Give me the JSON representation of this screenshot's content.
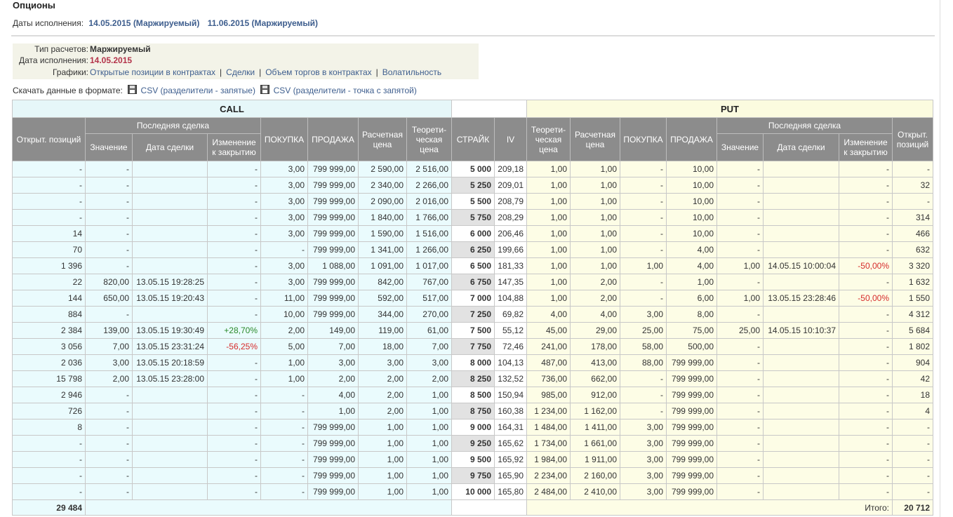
{
  "page": {
    "title": "Опционы",
    "dates_label": "Даты исполнения:",
    "date_links": [
      "14.05.2015 (Маржируемый)",
      "11.06.2015 (Маржируемый)"
    ]
  },
  "info": {
    "settlement_label": "Тип расчетов:",
    "settlement_value": "Маржируемый",
    "expiry_label": "Дата исполнения:",
    "expiry_value": "14.05.2015",
    "charts_label": "Графики:",
    "chart_links": [
      "Открытые позиции в контрактах",
      "Сделки",
      "Объем торгов в контрактах",
      "Волатильность"
    ],
    "separator": "|"
  },
  "download": {
    "label": "Скачать данные в формате:",
    "icon": "floppy-disk-icon",
    "links": [
      "CSV (разделители - запятые)",
      "CSV (разделители - точка с запятой)"
    ]
  },
  "table": {
    "call_title": "CALL",
    "put_title": "PUT",
    "headers": {
      "open_positions": "Открыт. позиций",
      "open_positions_put": "Открыт. позиций",
      "last_trade": "Последняя сделка",
      "value": "Значение",
      "trade_date": "Дата сделки",
      "change": "Изменение к закрытию",
      "buy": "ПОКУПКА",
      "sell": "ПРОДАЖА",
      "settle_price": "Расчетная цена",
      "theor_price": "Теорети-ческая цена",
      "strike": "СТРАЙК",
      "iv": "IV"
    },
    "rows": [
      {
        "c_oi": "-",
        "c_val": "-",
        "c_date": "",
        "c_chg": "-",
        "c_buy": "3,00",
        "c_sell": "799 999,00",
        "c_settle": "2 590,00",
        "c_theor": "2 516,00",
        "strike": "5 000",
        "iv": "209,18",
        "p_theor": "1,00",
        "p_settle": "1,00",
        "p_buy": "-",
        "p_sell": "10,00",
        "p_val": "-",
        "p_date": "",
        "p_chg": "-",
        "p_oi": "-"
      },
      {
        "c_oi": "-",
        "c_val": "-",
        "c_date": "",
        "c_chg": "-",
        "c_buy": "3,00",
        "c_sell": "799 999,00",
        "c_settle": "2 340,00",
        "c_theor": "2 266,00",
        "strike": "5 250",
        "iv": "209,01",
        "p_theor": "1,00",
        "p_settle": "1,00",
        "p_buy": "-",
        "p_sell": "10,00",
        "p_val": "-",
        "p_date": "",
        "p_chg": "-",
        "p_oi": "32"
      },
      {
        "c_oi": "-",
        "c_val": "-",
        "c_date": "",
        "c_chg": "-",
        "c_buy": "3,00",
        "c_sell": "799 999,00",
        "c_settle": "2 090,00",
        "c_theor": "2 016,00",
        "strike": "5 500",
        "iv": "208,79",
        "p_theor": "1,00",
        "p_settle": "1,00",
        "p_buy": "-",
        "p_sell": "10,00",
        "p_val": "-",
        "p_date": "",
        "p_chg": "-",
        "p_oi": "-"
      },
      {
        "c_oi": "-",
        "c_val": "-",
        "c_date": "",
        "c_chg": "-",
        "c_buy": "3,00",
        "c_sell": "799 999,00",
        "c_settle": "1 840,00",
        "c_theor": "1 766,00",
        "strike": "5 750",
        "iv": "208,29",
        "p_theor": "1,00",
        "p_settle": "1,00",
        "p_buy": "-",
        "p_sell": "10,00",
        "p_val": "-",
        "p_date": "",
        "p_chg": "-",
        "p_oi": "314"
      },
      {
        "c_oi": "14",
        "c_val": "-",
        "c_date": "",
        "c_chg": "-",
        "c_buy": "3,00",
        "c_sell": "799 999,00",
        "c_settle": "1 590,00",
        "c_theor": "1 516,00",
        "strike": "6 000",
        "iv": "206,46",
        "p_theor": "1,00",
        "p_settle": "1,00",
        "p_buy": "-",
        "p_sell": "10,00",
        "p_val": "-",
        "p_date": "",
        "p_chg": "-",
        "p_oi": "466"
      },
      {
        "c_oi": "70",
        "c_val": "-",
        "c_date": "",
        "c_chg": "-",
        "c_buy": "-",
        "c_sell": "799 999,00",
        "c_settle": "1 341,00",
        "c_theor": "1 266,00",
        "strike": "6 250",
        "iv": "199,66",
        "p_theor": "1,00",
        "p_settle": "1,00",
        "p_buy": "-",
        "p_sell": "4,00",
        "p_val": "-",
        "p_date": "",
        "p_chg": "-",
        "p_oi": "632"
      },
      {
        "c_oi": "1 396",
        "c_val": "-",
        "c_date": "",
        "c_chg": "-",
        "c_buy": "3,00",
        "c_sell": "1 088,00",
        "c_settle": "1 091,00",
        "c_theor": "1 017,00",
        "strike": "6 500",
        "iv": "181,33",
        "p_theor": "1,00",
        "p_settle": "1,00",
        "p_buy": "1,00",
        "p_sell": "4,00",
        "p_val": "1,00",
        "p_date": "14.05.15 10:00:04",
        "p_chg": "-50,00%",
        "p_oi": "3 320"
      },
      {
        "c_oi": "22",
        "c_val": "820,00",
        "c_date": "13.05.15 19:28:25",
        "c_chg": "-",
        "c_buy": "3,00",
        "c_sell": "799 999,00",
        "c_settle": "842,00",
        "c_theor": "767,00",
        "strike": "6 750",
        "iv": "147,35",
        "p_theor": "1,00",
        "p_settle": "2,00",
        "p_buy": "-",
        "p_sell": "1,00",
        "p_val": "-",
        "p_date": "",
        "p_chg": "-",
        "p_oi": "1 632"
      },
      {
        "c_oi": "144",
        "c_val": "650,00",
        "c_date": "13.05.15 19:20:43",
        "c_chg": "-",
        "c_buy": "11,00",
        "c_sell": "799 999,00",
        "c_settle": "592,00",
        "c_theor": "517,00",
        "strike": "7 000",
        "iv": "104,88",
        "p_theor": "1,00",
        "p_settle": "2,00",
        "p_buy": "-",
        "p_sell": "6,00",
        "p_val": "1,00",
        "p_date": "13.05.15 23:28:46",
        "p_chg": "-50,00%",
        "p_oi": "1 550"
      },
      {
        "c_oi": "884",
        "c_val": "-",
        "c_date": "",
        "c_chg": "-",
        "c_buy": "10,00",
        "c_sell": "799 999,00",
        "c_settle": "344,00",
        "c_theor": "270,00",
        "strike": "7 250",
        "iv": "69,82",
        "p_theor": "4,00",
        "p_settle": "4,00",
        "p_buy": "3,00",
        "p_sell": "8,00",
        "p_val": "-",
        "p_date": "",
        "p_chg": "-",
        "p_oi": "4 312"
      },
      {
        "c_oi": "2 384",
        "c_val": "139,00",
        "c_date": "13.05.15 19:30:49",
        "c_chg": "+28,70%",
        "c_buy": "2,00",
        "c_sell": "149,00",
        "c_settle": "119,00",
        "c_theor": "61,00",
        "strike": "7 500",
        "iv": "55,12",
        "p_theor": "45,00",
        "p_settle": "29,00",
        "p_buy": "25,00",
        "p_sell": "75,00",
        "p_val": "25,00",
        "p_date": "14.05.15 10:10:37",
        "p_chg": "-",
        "p_oi": "5 684"
      },
      {
        "c_oi": "3 056",
        "c_val": "7,00",
        "c_date": "13.05.15 23:31:24",
        "c_chg": "-56,25%",
        "c_buy": "5,00",
        "c_sell": "7,00",
        "c_settle": "18,00",
        "c_theor": "7,00",
        "strike": "7 750",
        "iv": "72,46",
        "p_theor": "241,00",
        "p_settle": "178,00",
        "p_buy": "58,00",
        "p_sell": "500,00",
        "p_val": "-",
        "p_date": "",
        "p_chg": "-",
        "p_oi": "1 802"
      },
      {
        "c_oi": "2 036",
        "c_val": "3,00",
        "c_date": "13.05.15 20:18:59",
        "c_chg": "-",
        "c_buy": "1,00",
        "c_sell": "3,00",
        "c_settle": "3,00",
        "c_theor": "3,00",
        "strike": "8 000",
        "iv": "104,13",
        "p_theor": "487,00",
        "p_settle": "413,00",
        "p_buy": "88,00",
        "p_sell": "799 999,00",
        "p_val": "-",
        "p_date": "",
        "p_chg": "-",
        "p_oi": "904"
      },
      {
        "c_oi": "15 798",
        "c_val": "2,00",
        "c_date": "13.05.15 23:28:00",
        "c_chg": "-",
        "c_buy": "1,00",
        "c_sell": "2,00",
        "c_settle": "2,00",
        "c_theor": "2,00",
        "strike": "8 250",
        "iv": "132,52",
        "p_theor": "736,00",
        "p_settle": "662,00",
        "p_buy": "-",
        "p_sell": "799 999,00",
        "p_val": "-",
        "p_date": "",
        "p_chg": "-",
        "p_oi": "42"
      },
      {
        "c_oi": "2 946",
        "c_val": "-",
        "c_date": "",
        "c_chg": "-",
        "c_buy": "-",
        "c_sell": "4,00",
        "c_settle": "2,00",
        "c_theor": "1,00",
        "strike": "8 500",
        "iv": "150,94",
        "p_theor": "985,00",
        "p_settle": "912,00",
        "p_buy": "-",
        "p_sell": "799 999,00",
        "p_val": "-",
        "p_date": "",
        "p_chg": "-",
        "p_oi": "18"
      },
      {
        "c_oi": "726",
        "c_val": "-",
        "c_date": "",
        "c_chg": "-",
        "c_buy": "-",
        "c_sell": "1,00",
        "c_settle": "2,00",
        "c_theor": "1,00",
        "strike": "8 750",
        "iv": "160,38",
        "p_theor": "1 234,00",
        "p_settle": "1 162,00",
        "p_buy": "-",
        "p_sell": "799 999,00",
        "p_val": "-",
        "p_date": "",
        "p_chg": "-",
        "p_oi": "4"
      },
      {
        "c_oi": "8",
        "c_val": "-",
        "c_date": "",
        "c_chg": "-",
        "c_buy": "-",
        "c_sell": "799 999,00",
        "c_settle": "1,00",
        "c_theor": "1,00",
        "strike": "9 000",
        "iv": "164,31",
        "p_theor": "1 484,00",
        "p_settle": "1 411,00",
        "p_buy": "3,00",
        "p_sell": "799 999,00",
        "p_val": "-",
        "p_date": "",
        "p_chg": "-",
        "p_oi": "-"
      },
      {
        "c_oi": "-",
        "c_val": "-",
        "c_date": "",
        "c_chg": "-",
        "c_buy": "-",
        "c_sell": "799 999,00",
        "c_settle": "1,00",
        "c_theor": "1,00",
        "strike": "9 250",
        "iv": "165,62",
        "p_theor": "1 734,00",
        "p_settle": "1 661,00",
        "p_buy": "3,00",
        "p_sell": "799 999,00",
        "p_val": "-",
        "p_date": "",
        "p_chg": "-",
        "p_oi": "-"
      },
      {
        "c_oi": "-",
        "c_val": "-",
        "c_date": "",
        "c_chg": "-",
        "c_buy": "-",
        "c_sell": "799 999,00",
        "c_settle": "1,00",
        "c_theor": "1,00",
        "strike": "9 500",
        "iv": "165,92",
        "p_theor": "1 984,00",
        "p_settle": "1 911,00",
        "p_buy": "3,00",
        "p_sell": "799 999,00",
        "p_val": "-",
        "p_date": "",
        "p_chg": "-",
        "p_oi": "-"
      },
      {
        "c_oi": "-",
        "c_val": "-",
        "c_date": "",
        "c_chg": "-",
        "c_buy": "-",
        "c_sell": "799 999,00",
        "c_settle": "1,00",
        "c_theor": "1,00",
        "strike": "9 750",
        "iv": "165,90",
        "p_theor": "2 234,00",
        "p_settle": "2 160,00",
        "p_buy": "3,00",
        "p_sell": "799 999,00",
        "p_val": "-",
        "p_date": "",
        "p_chg": "-",
        "p_oi": "-"
      },
      {
        "c_oi": "-",
        "c_val": "-",
        "c_date": "",
        "c_chg": "-",
        "c_buy": "-",
        "c_sell": "799 999,00",
        "c_settle": "1,00",
        "c_theor": "1,00",
        "strike": "10 000",
        "iv": "165,80",
        "p_theor": "2 484,00",
        "p_settle": "2 410,00",
        "p_buy": "3,00",
        "p_sell": "799 999,00",
        "p_val": "-",
        "p_date": "",
        "p_chg": "-",
        "p_oi": "-"
      }
    ],
    "totals": {
      "call_total": "29 484",
      "itogo_label": "Итого:",
      "put_total": "20 712"
    }
  }
}
